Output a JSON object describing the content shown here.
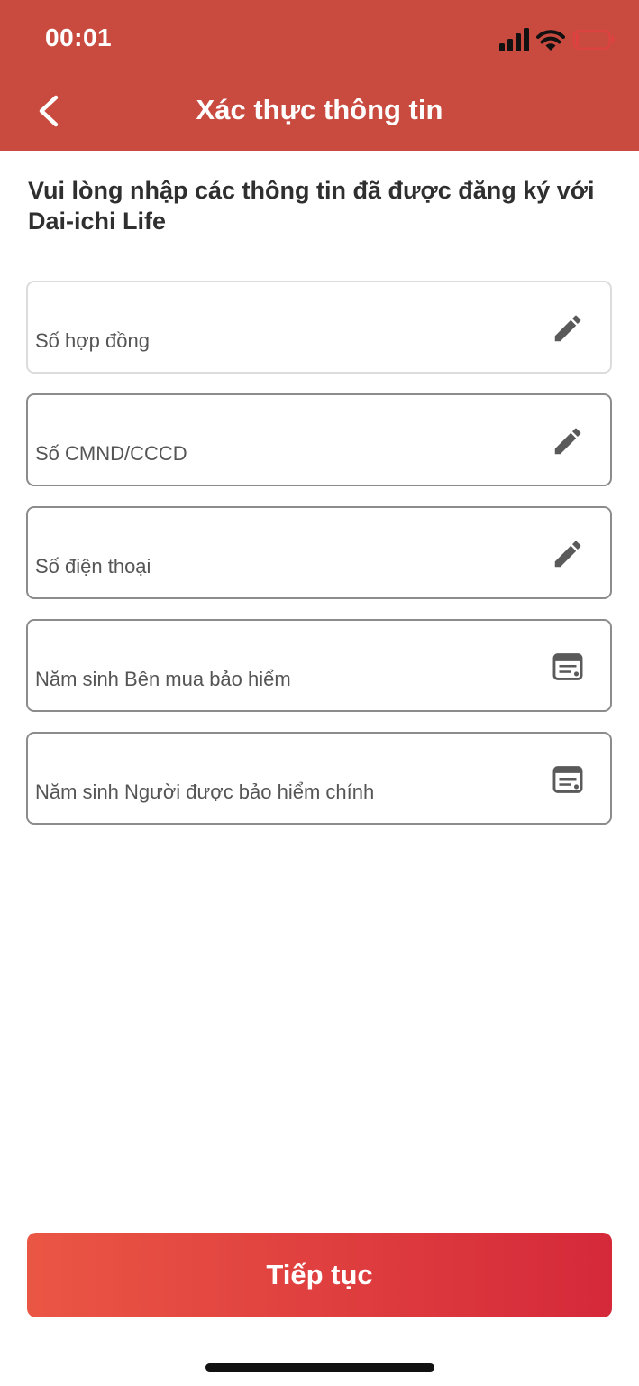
{
  "status_bar": {
    "time": "00:01",
    "icons": [
      "cellular-signal-icon",
      "wifi-icon",
      "battery-low-icon"
    ]
  },
  "header": {
    "back_icon": "chevron-left-icon",
    "title": "Xác thực thông tin"
  },
  "instruction": "Vui lòng nhập các thông tin đã được đăng ký với Dai-ichi Life",
  "fields": [
    {
      "label": "Số hợp đồng",
      "icon": "pencil-icon"
    },
    {
      "label": "Số CMND/CCCD",
      "icon": "pencil-icon"
    },
    {
      "label": "Số điện thoại",
      "icon": "pencil-icon"
    },
    {
      "label": "Năm sinh Bên mua bảo hiểm",
      "icon": "calendar-icon"
    },
    {
      "label": "Năm sinh Người được bảo hiểm chính",
      "icon": "calendar-icon"
    }
  ],
  "continue_button": "Tiếp tục",
  "colors": {
    "header_background": "#c94b40",
    "button_gradient_start": "#ea5644",
    "button_gradient_end": "#d5293a",
    "battery_low": "#e04040"
  }
}
